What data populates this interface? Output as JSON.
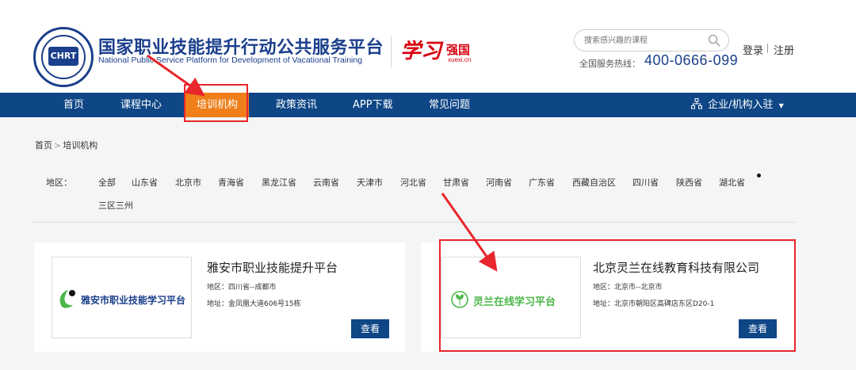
{
  "header": {
    "logo_text": "CHRT",
    "title_cn": "国家职业技能提升行动公共服务平台",
    "title_en": "National Public Service Platform for Development of Vacational Training",
    "xuexi_script": "学习",
    "xuexi_cn": "强国",
    "xuexi_url": "xuexi.cn",
    "search_placeholder": "搜索感兴趣的课程",
    "hotline_label": "全国服务热线：",
    "hotline_number": "400-0666-099",
    "login": "登录",
    "register": "注册"
  },
  "nav": {
    "items": [
      "首页",
      "课程中心",
      "培训机构",
      "政策资讯",
      "APP下载",
      "常见问题"
    ],
    "active_index": 2,
    "enterprise": "企业/机构入驻"
  },
  "breadcrumb": {
    "home": "首页",
    "separator": ">",
    "current": "培训机构"
  },
  "filter": {
    "label": "地区：",
    "regions": [
      "全部",
      "山东省",
      "北京市",
      "青海省",
      "黑龙江省",
      "云南省",
      "天津市",
      "河北省",
      "甘肃省",
      "河南省",
      "广东省",
      "西藏自治区",
      "四川省",
      "陕西省",
      "湖北省",
      "三区三州"
    ]
  },
  "cards": [
    {
      "logo_text": "雅安市职业技能学习平台",
      "name": "雅安市职业技能提升平台",
      "region": "地区：四川省--成都市",
      "address": "地址：金凤凰大道606号15栋",
      "button": "查看"
    },
    {
      "logo_text": "灵兰在线学习平台",
      "name": "北京灵兰在线教育科技有限公司",
      "region": "地区：北京市--北京市",
      "address": "地址：北京市朝阳区高碑店东区D20-1",
      "button": "查看"
    }
  ],
  "colors": {
    "brand_blue": "#0e4686",
    "nav_active": "#f07f1a",
    "annotation_red": "#e8262c",
    "xuexi_red": "#d7000f",
    "lingyan_green": "#4cb748"
  }
}
